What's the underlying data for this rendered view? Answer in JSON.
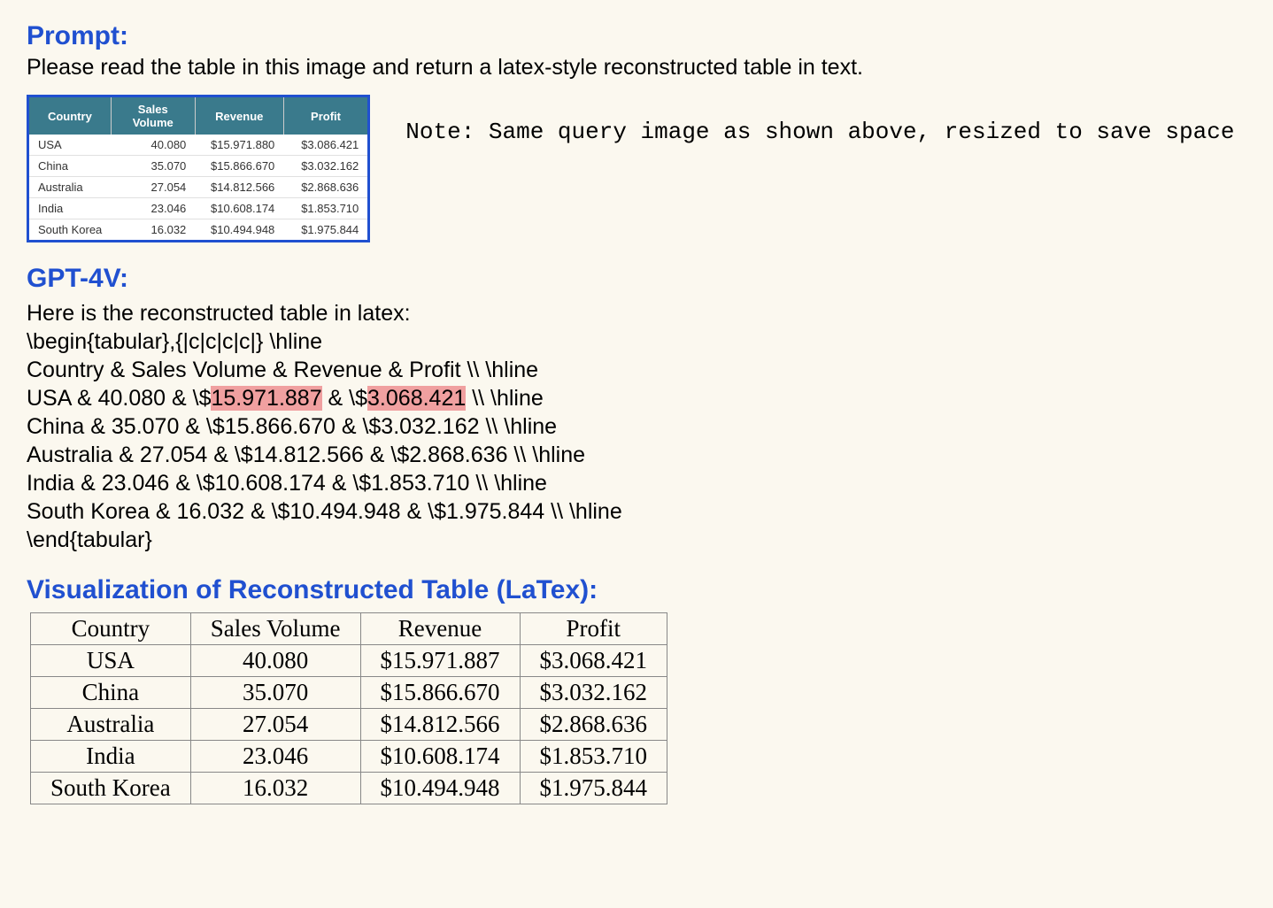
{
  "prompt": {
    "heading": "Prompt:",
    "text": "Please read the table in this image and return a latex-style reconstructed table in text."
  },
  "source_table": {
    "headers": [
      "Country",
      "Sales Volume",
      "Revenue",
      "Profit"
    ],
    "rows": [
      {
        "country": "USA",
        "sales": "40.080",
        "revenue": "$15.971.880",
        "profit": "$3.086.421"
      },
      {
        "country": "China",
        "sales": "35.070",
        "revenue": "$15.866.670",
        "profit": "$3.032.162"
      },
      {
        "country": "Australia",
        "sales": "27.054",
        "revenue": "$14.812.566",
        "profit": "$2.868.636"
      },
      {
        "country": "India",
        "sales": "23.046",
        "revenue": "$10.608.174",
        "profit": "$1.853.710"
      },
      {
        "country": "South Korea",
        "sales": "16.032",
        "revenue": "$10.494.948",
        "profit": "$1.975.844"
      }
    ]
  },
  "note": "Note: Same query image as shown above, resized to save space",
  "gpt": {
    "heading": "GPT-4V:",
    "intro": "Here is the reconstructed table in latex:",
    "line_begin": "\\begin{tabular},{|c|c|c|c|} \\hline",
    "line_header": "Country & Sales Volume & Revenue & Profit \\\\ \\hline",
    "line_usa_p1": "USA & 40.080 & \\$",
    "line_usa_hl1": "15.971.887",
    "line_usa_p2": " & \\$",
    "line_usa_hl2": "3.068.421",
    "line_usa_p3": " \\\\ \\hline",
    "line_china": "China & 35.070 & \\$15.866.670 & \\$3.032.162 \\\\ \\hline",
    "line_aus": "Australia & 27.054 & \\$14.812.566 & \\$2.868.636 \\\\ \\hline",
    "line_india": "India & 23.046 & \\$10.608.174 & \\$1.853.710 \\\\ \\hline",
    "line_sk": "South Korea & 16.032 & \\$10.494.948 & \\$1.975.844 \\\\ \\hline",
    "line_end": "\\end{tabular}"
  },
  "viz": {
    "heading": "Visualization of Reconstructed Table (LaTex):",
    "headers": [
      "Country",
      "Sales Volume",
      "Revenue",
      "Profit"
    ],
    "rows": [
      {
        "country": "USA",
        "sales": "40.080",
        "revenue": "$15.971.887",
        "profit": "$3.068.421"
      },
      {
        "country": "China",
        "sales": "35.070",
        "revenue": "$15.866.670",
        "profit": "$3.032.162"
      },
      {
        "country": "Australia",
        "sales": "27.054",
        "revenue": "$14.812.566",
        "profit": "$2.868.636"
      },
      {
        "country": "India",
        "sales": "23.046",
        "revenue": "$10.608.174",
        "profit": "$1.853.710"
      },
      {
        "country": "South Korea",
        "sales": "16.032",
        "revenue": "$10.494.948",
        "profit": "$1.975.844"
      }
    ]
  },
  "chart_data": {
    "type": "table",
    "title": "Source sales table vs GPT-4V LaTeX reconstruction",
    "source_headers": [
      "Country",
      "Sales Volume",
      "Revenue",
      "Profit"
    ],
    "source_rows": [
      [
        "USA",
        "40.080",
        "$15.971.880",
        "$3.086.421"
      ],
      [
        "China",
        "35.070",
        "$15.866.670",
        "$3.032.162"
      ],
      [
        "Australia",
        "27.054",
        "$14.812.566",
        "$2.868.636"
      ],
      [
        "India",
        "23.046",
        "$10.608.174",
        "$1.853.710"
      ],
      [
        "South Korea",
        "16.032",
        "$10.494.948",
        "$1.975.844"
      ]
    ],
    "reconstructed_rows": [
      [
        "USA",
        "40.080",
        "$15.971.887",
        "$3.068.421"
      ],
      [
        "China",
        "35.070",
        "$15.866.670",
        "$3.032.162"
      ],
      [
        "Australia",
        "27.054",
        "$14.812.566",
        "$2.868.636"
      ],
      [
        "India",
        "23.046",
        "$10.608.174",
        "$1.853.710"
      ],
      [
        "South Korea",
        "16.032",
        "$10.494.948",
        "$1.975.844"
      ]
    ],
    "highlighted_errors": [
      {
        "row": "USA",
        "column": "Revenue",
        "source": "$15.971.880",
        "reconstructed": "$15.971.887"
      },
      {
        "row": "USA",
        "column": "Profit",
        "source": "$3.086.421",
        "reconstructed": "$3.068.421"
      }
    ]
  }
}
